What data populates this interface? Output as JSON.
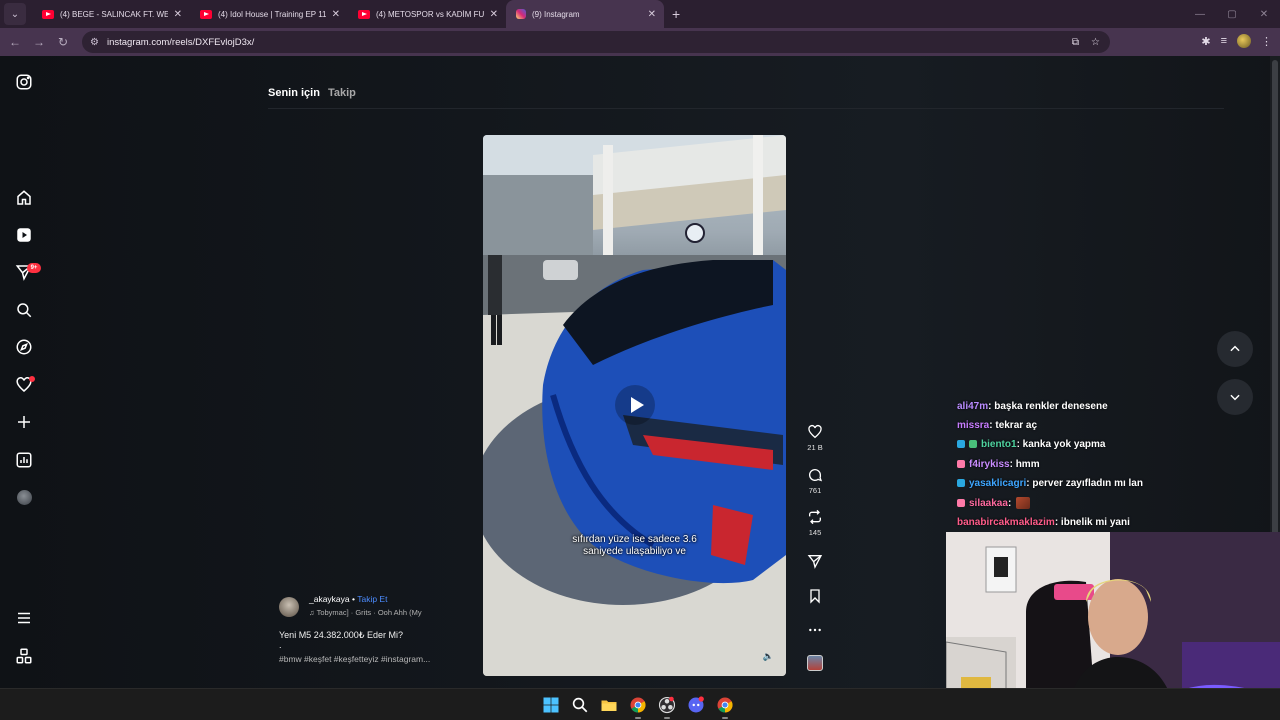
{
  "browser": {
    "tabs": [
      {
        "title": "(4) BEGE - SALINCAK FT. WEGH",
        "icon": "youtube-icon",
        "active": false
      },
      {
        "title": "(4) Idol House | Training EP 11 |",
        "icon": "youtube-icon",
        "active": false
      },
      {
        "title": "(4) METOSPOR vs KADİM FUTB",
        "icon": "youtube-icon",
        "active": false
      },
      {
        "title": "(9) Instagram",
        "icon": "instagram-icon",
        "active": true
      }
    ],
    "url": "instagram.com/reels/DXFEvlojD3x/"
  },
  "sidebar": {
    "notifications_badge": "9+"
  },
  "feed_tabs": {
    "for_you": "Senin için",
    "following": "Takip"
  },
  "reel": {
    "caption_line1": "sıfırdan yüze ise sadece 3.6",
    "caption_line2": "saniyede ulaşabiliyo ve",
    "author": "_akaykaya",
    "separator": "•",
    "follow_label": "Takip Et",
    "song": "Tobymac] · Grits · Ooh Ahh (My",
    "description": "Yeni M5 24.382.000₺ Eder Mi?",
    "description_dot": ".",
    "hashtags": "#bmw #keşfet #keşfetteyiz #instagram...",
    "likes": "21 B",
    "comments": "761",
    "reposts": "145"
  },
  "chat": [
    {
      "user": "ali47m",
      "text": " : başka renkler denesene",
      "color": "#b98cff",
      "badges": []
    },
    {
      "user": "missra",
      "text": " : tekrar aç",
      "color": "#c77dff",
      "badges": []
    },
    {
      "user": "biento1",
      "text": " : kanka yok yapma",
      "color": "#4fd3a0",
      "badges": [
        "#2aa8e0",
        "#49c07a"
      ]
    },
    {
      "user": "f4irykiss",
      "text": " : hmm",
      "color": "#c98cff",
      "badges": [
        "#ff7aa8"
      ]
    },
    {
      "user": "yasaklicagri",
      "text": " : perver zayıfladın mı lan",
      "color": "#3ea6ff",
      "badges": [
        "#2aa8e0"
      ]
    },
    {
      "user": "silaakaa",
      "text": " :",
      "color": "#ff6aa0",
      "badges": [
        "#ff7aa8"
      ],
      "emote": true
    },
    {
      "user": "banabircakmaklazim",
      "text": " : ibnelik mi yani",
      "color": "#ff5c8a",
      "badges": []
    }
  ]
}
